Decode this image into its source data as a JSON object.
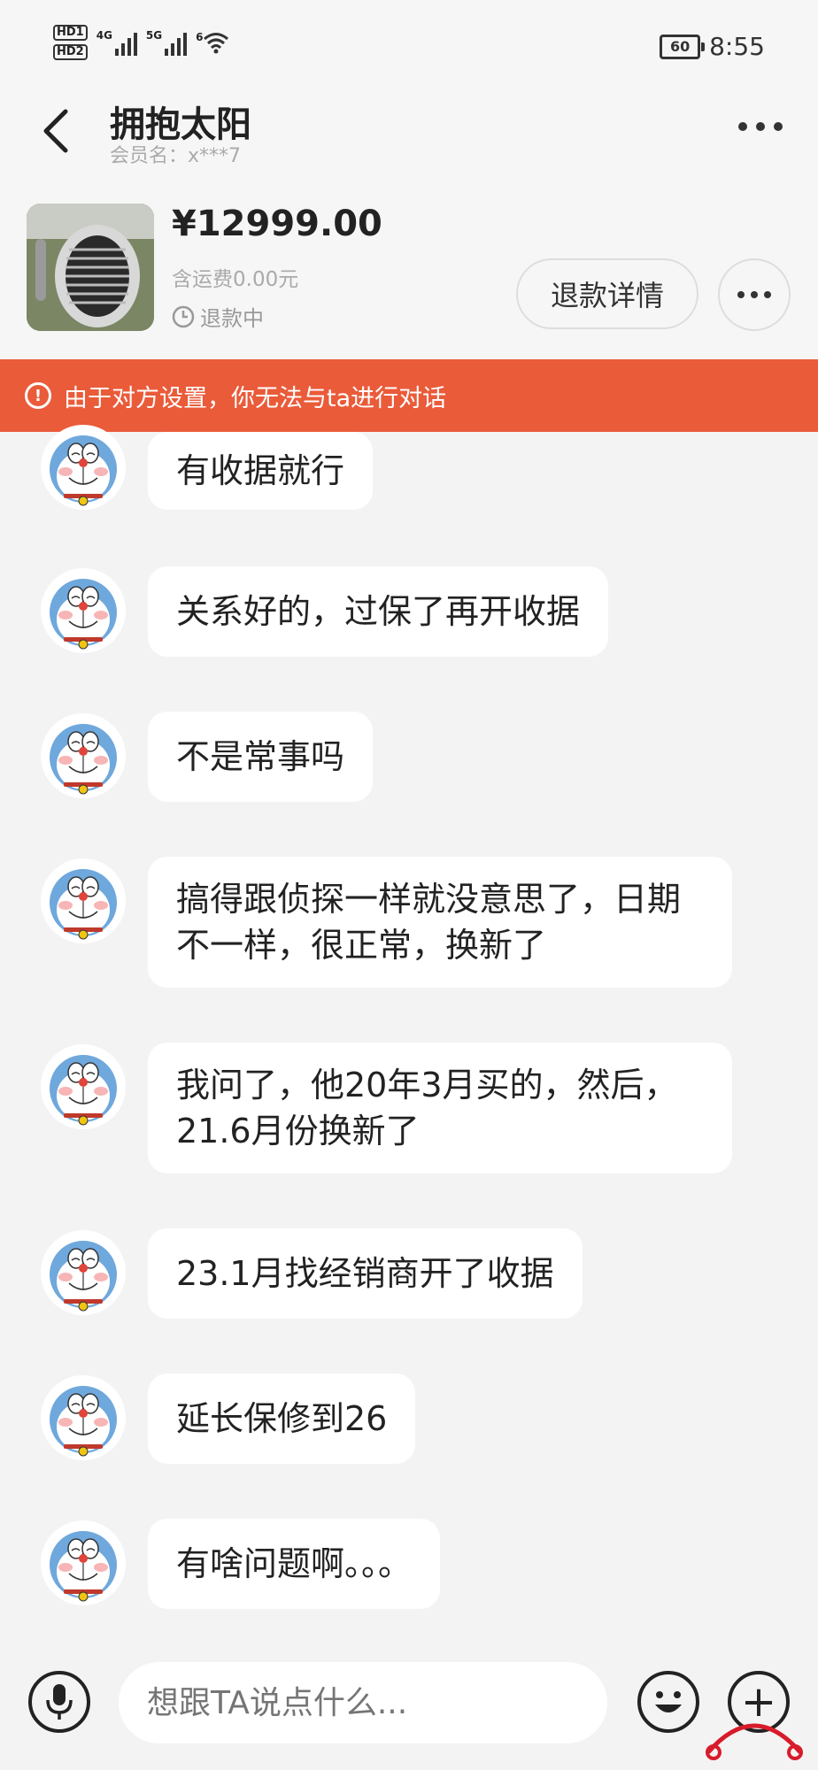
{
  "status_bar": {
    "hd1": "HD1",
    "hd2": "HD2",
    "net1": "4G",
    "net2": "5G",
    "wifi_label": "6",
    "battery": "60",
    "time": "8:55"
  },
  "header": {
    "title": "拥抱太阳",
    "member": "会员名：x***7"
  },
  "product": {
    "price": "¥12999.00",
    "shipping": "含运费0.00元",
    "status": "退款中",
    "refund_button": "退款详情"
  },
  "warning": {
    "text": "由于对方设置，你无法与ta进行对话"
  },
  "messages": [
    {
      "text": "有收据就行"
    },
    {
      "text": "关系好的，过保了再开收据"
    },
    {
      "text": "不是常事吗"
    },
    {
      "text": "搞得跟侦探一样就没意思了，日期不一样，很正常，换新了"
    },
    {
      "text": "我问了，他20年3月买的，然后，21.6月份换新了"
    },
    {
      "text": "23.1月找经销商开了收据"
    },
    {
      "text": "延长保修到26"
    },
    {
      "text": "有啥问题啊。。。"
    }
  ],
  "input": {
    "placeholder": "想跟TA说点什么..."
  },
  "colors": {
    "warning_bg": "#ea5b3a",
    "background": "#f3f3f3"
  }
}
